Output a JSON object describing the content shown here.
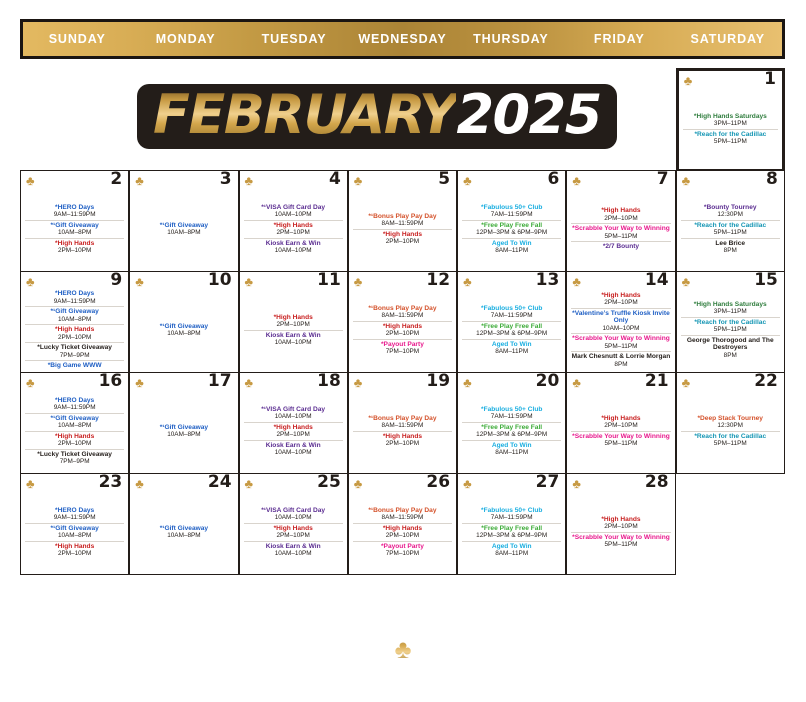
{
  "header": {
    "weekdays": [
      "SUNDAY",
      "MONDAY",
      "TUESDAY",
      "WEDNESDAY",
      "THURSDAY",
      "FRIDAY",
      "SATURDAY"
    ]
  },
  "title": {
    "month": "FEBRUARY",
    "year": "2025"
  },
  "icons": {
    "club": "♣",
    "footer_club": "♣"
  },
  "colors": {
    "header_gold": "#c39a44",
    "frame_dark": "#231d19",
    "blue": "#1f5fc4",
    "red": "#c81f1f",
    "purple": "#5b2d91",
    "cyan": "#19aee0",
    "green": "#3aaa35",
    "dark_green": "#2f7d3d",
    "teal": "#1596b4",
    "pink": "#e8188c",
    "black": "#231d19",
    "orange": "#d4512a"
  },
  "weeks": [
    {
      "leading_blanks": 6,
      "days": [
        {
          "num": "1",
          "events": [
            {
              "name": "*High Hands Saturdays",
              "time": "3PM–11PM",
              "color": "c-darkgreen"
            },
            {
              "name": "*Reach for the Cadillac",
              "time": "5PM–11PM",
              "color": "c-teal"
            }
          ]
        }
      ]
    },
    {
      "leading_blanks": 0,
      "days": [
        {
          "num": "2",
          "events": [
            {
              "name": "*HERO Days",
              "time": "9AM–11:59PM",
              "color": "c-blue"
            },
            {
              "name": "*¹Gift Giveaway",
              "time": "10AM–8PM",
              "color": "c-blue"
            },
            {
              "name": "*High Hands",
              "time": "2PM–10PM",
              "color": "c-red"
            }
          ]
        },
        {
          "num": "3",
          "events": [
            {
              "name": "*¹Gift Giveaway",
              "time": "10AM–8PM",
              "color": "c-blue"
            }
          ]
        },
        {
          "num": "4",
          "events": [
            {
              "name": "*¹VISA Gift Card Day",
              "time": "10AM–10PM",
              "color": "c-purple"
            },
            {
              "name": "*High Hands",
              "time": "2PM–10PM",
              "color": "c-red"
            },
            {
              "name": "Kiosk Earn & Win",
              "time": "10AM–10PM",
              "color": "c-purple"
            }
          ]
        },
        {
          "num": "5",
          "events": [
            {
              "name": "*¹Bonus Play Pay Day",
              "time": "8AM–11:59PM",
              "color": "c-orange"
            },
            {
              "name": "*High Hands",
              "time": "2PM–10PM",
              "color": "c-red"
            }
          ]
        },
        {
          "num": "6",
          "events": [
            {
              "name": "*Fabulous 50+ Club",
              "time": "7AM–11:59PM",
              "color": "c-cyan"
            },
            {
              "name": "*Free Play Free Fall",
              "time": "12PM–3PM & 6PM–9PM",
              "color": "c-green"
            },
            {
              "name": "Aged To Win",
              "time": "8AM–11PM",
              "color": "c-cyan"
            }
          ]
        },
        {
          "num": "7",
          "events": [
            {
              "name": "*High Hands",
              "time": "2PM–10PM",
              "color": "c-red"
            },
            {
              "name": "*Scrabble Your Way to Winning",
              "time": "5PM–11PM",
              "color": "c-pink"
            },
            {
              "name": "*2/7 Bounty",
              "time": "",
              "color": "c-purple"
            }
          ]
        },
        {
          "num": "8",
          "events": [
            {
              "name": "*Bounty Tourney",
              "time": "12:30PM",
              "color": "c-purple"
            },
            {
              "name": "*Reach for the Cadillac",
              "time": "5PM–11PM",
              "color": "c-teal"
            },
            {
              "name": "Lee Brice",
              "time": "8PM",
              "color": "c-black"
            }
          ]
        }
      ]
    },
    {
      "leading_blanks": 0,
      "days": [
        {
          "num": "9",
          "events": [
            {
              "name": "*HERO Days",
              "time": "9AM–11:59PM",
              "color": "c-blue"
            },
            {
              "name": "*¹Gift Giveaway",
              "time": "10AM–8PM",
              "color": "c-blue"
            },
            {
              "name": "*High Hands",
              "time": "2PM–10PM",
              "color": "c-red"
            },
            {
              "name": "*Lucky Ticket Giveaway",
              "time": "7PM–9PM",
              "color": "c-black"
            },
            {
              "name": "*Big Game WWW",
              "time": "",
              "color": "c-blue"
            }
          ]
        },
        {
          "num": "10",
          "events": [
            {
              "name": "*¹Gift Giveaway",
              "time": "10AM–8PM",
              "color": "c-blue"
            }
          ]
        },
        {
          "num": "11",
          "events": [
            {
              "name": "*High Hands",
              "time": "2PM–10PM",
              "color": "c-red"
            },
            {
              "name": "Kiosk Earn & Win",
              "time": "10AM–10PM",
              "color": "c-purple"
            }
          ]
        },
        {
          "num": "12",
          "events": [
            {
              "name": "*¹Bonus Play Pay Day",
              "time": "8AM–11:59PM",
              "color": "c-orange"
            },
            {
              "name": "*High Hands",
              "time": "2PM–10PM",
              "color": "c-red"
            },
            {
              "name": "*Payout Party",
              "time": "7PM–10PM",
              "color": "c-pink"
            }
          ]
        },
        {
          "num": "13",
          "events": [
            {
              "name": "*Fabulous 50+ Club",
              "time": "7AM–11:59PM",
              "color": "c-cyan"
            },
            {
              "name": "*Free Play Free Fall",
              "time": "12PM–3PM & 6PM–9PM",
              "color": "c-green"
            },
            {
              "name": "Aged To Win",
              "time": "8AM–11PM",
              "color": "c-cyan"
            }
          ]
        },
        {
          "num": "14",
          "events": [
            {
              "name": "*High Hands",
              "time": "2PM–10PM",
              "color": "c-red"
            },
            {
              "name": "*Valentine’s Truffle Kiosk Invite Only",
              "time": "10AM–10PM",
              "color": "c-blue"
            },
            {
              "name": "*Scrabble Your Way to Winning",
              "time": "5PM–11PM",
              "color": "c-pink"
            },
            {
              "name": "Mark Chesnutt & Lorrie Morgan",
              "time": "8PM",
              "color": "c-black"
            }
          ]
        },
        {
          "num": "15",
          "events": [
            {
              "name": "*High Hands Saturdays",
              "time": "3PM–11PM",
              "color": "c-darkgreen"
            },
            {
              "name": "*Reach for the Cadillac",
              "time": "5PM–11PM",
              "color": "c-teal"
            },
            {
              "name": "George Thorogood and The Destroyers",
              "time": "8PM",
              "color": "c-black"
            }
          ]
        }
      ]
    },
    {
      "leading_blanks": 0,
      "days": [
        {
          "num": "16",
          "events": [
            {
              "name": "*HERO Days",
              "time": "9AM–11:59PM",
              "color": "c-blue"
            },
            {
              "name": "*¹Gift Giveaway",
              "time": "10AM–8PM",
              "color": "c-blue"
            },
            {
              "name": "*High Hands",
              "time": "2PM–10PM",
              "color": "c-red"
            },
            {
              "name": "*Lucky Ticket Giveaway",
              "time": "7PM–9PM",
              "color": "c-black"
            }
          ]
        },
        {
          "num": "17",
          "events": [
            {
              "name": "*¹Gift Giveaway",
              "time": "10AM–8PM",
              "color": "c-blue"
            }
          ]
        },
        {
          "num": "18",
          "events": [
            {
              "name": "*¹VISA Gift Card Day",
              "time": "10AM–10PM",
              "color": "c-purple"
            },
            {
              "name": "*High Hands",
              "time": "2PM–10PM",
              "color": "c-red"
            },
            {
              "name": "Kiosk Earn & Win",
              "time": "10AM–10PM",
              "color": "c-purple"
            }
          ]
        },
        {
          "num": "19",
          "events": [
            {
              "name": "*¹Bonus Play Pay Day",
              "time": "8AM–11:59PM",
              "color": "c-orange"
            },
            {
              "name": "*High Hands",
              "time": "2PM–10PM",
              "color": "c-red"
            }
          ]
        },
        {
          "num": "20",
          "events": [
            {
              "name": "*Fabulous 50+ Club",
              "time": "7AM–11:59PM",
              "color": "c-cyan"
            },
            {
              "name": "*Free Play Free Fall",
              "time": "12PM–3PM & 6PM–9PM",
              "color": "c-green"
            },
            {
              "name": "Aged To Win",
              "time": "8AM–11PM",
              "color": "c-cyan"
            }
          ]
        },
        {
          "num": "21",
          "events": [
            {
              "name": "*High Hands",
              "time": "2PM–10PM",
              "color": "c-red"
            },
            {
              "name": "*Scrabble Your Way to Winning",
              "time": "5PM–11PM",
              "color": "c-pink"
            }
          ]
        },
        {
          "num": "22",
          "events": [
            {
              "name": "*Deep Stack Tourney",
              "time": "12:30PM",
              "color": "c-orange"
            },
            {
              "name": "*Reach for the Cadillac",
              "time": "5PM–11PM",
              "color": "c-teal"
            }
          ]
        }
      ]
    },
    {
      "leading_blanks": 0,
      "days": [
        {
          "num": "23",
          "events": [
            {
              "name": "*HERO Days",
              "time": "9AM–11:59PM",
              "color": "c-blue"
            },
            {
              "name": "*¹Gift Giveaway",
              "time": "10AM–8PM",
              "color": "c-blue"
            },
            {
              "name": "*High Hands",
              "time": "2PM–10PM",
              "color": "c-red"
            }
          ]
        },
        {
          "num": "24",
          "events": [
            {
              "name": "*¹Gift Giveaway",
              "time": "10AM–8PM",
              "color": "c-blue"
            }
          ]
        },
        {
          "num": "25",
          "events": [
            {
              "name": "*¹VISA Gift Card Day",
              "time": "10AM–10PM",
              "color": "c-purple"
            },
            {
              "name": "*High Hands",
              "time": "2PM–10PM",
              "color": "c-red"
            },
            {
              "name": "Kiosk Earn & Win",
              "time": "10AM–10PM",
              "color": "c-purple"
            }
          ]
        },
        {
          "num": "26",
          "events": [
            {
              "name": "*¹Bonus Play Pay Day",
              "time": "8AM–11:59PM",
              "color": "c-orange"
            },
            {
              "name": "*High Hands",
              "time": "2PM–10PM",
              "color": "c-red"
            },
            {
              "name": "*Payout Party",
              "time": "7PM–10PM",
              "color": "c-pink"
            }
          ]
        },
        {
          "num": "27",
          "events": [
            {
              "name": "*Fabulous 50+ Club",
              "time": "7AM–11:59PM",
              "color": "c-cyan"
            },
            {
              "name": "*Free Play Free Fall",
              "time": "12PM–3PM & 6PM–9PM",
              "color": "c-green"
            },
            {
              "name": "Aged To Win",
              "time": "8AM–11PM",
              "color": "c-cyan"
            }
          ]
        },
        {
          "num": "28",
          "events": [
            {
              "name": "*High Hands",
              "time": "2PM–10PM",
              "color": "c-red"
            },
            {
              "name": "*Scrabble Your Way to Winning",
              "time": "5PM–11PM",
              "color": "c-pink"
            }
          ]
        }
      ]
    }
  ]
}
